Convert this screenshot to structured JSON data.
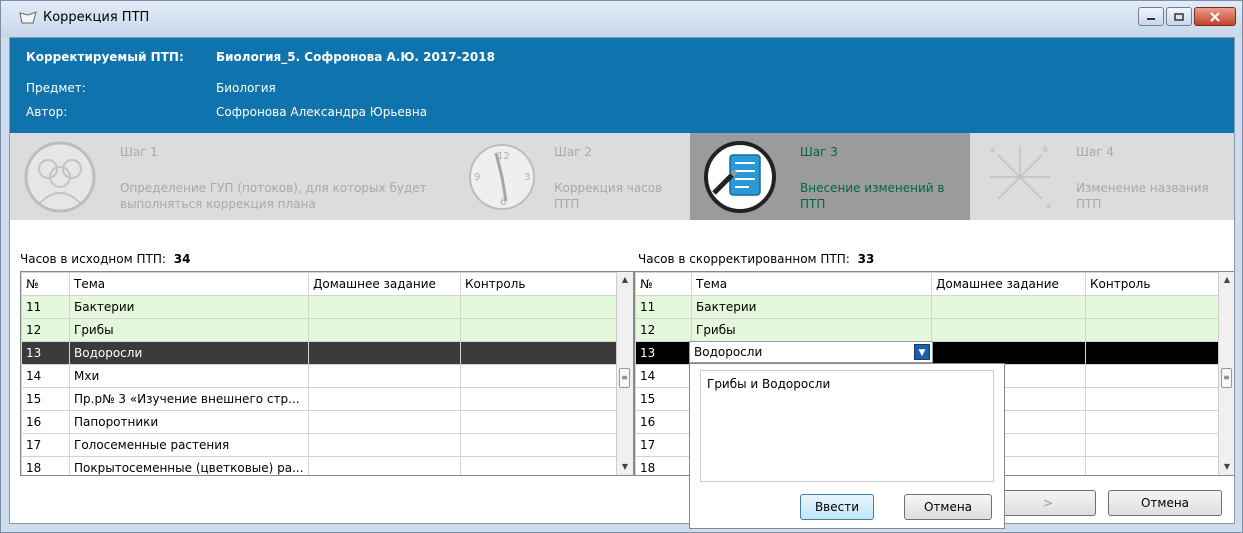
{
  "window": {
    "title": "Коррекция ПТП"
  },
  "header": {
    "corrected_label": "Корректируемый ПТП:",
    "corrected_value": "Биология_5. Софронова А.Ю. 2017-2018",
    "subject_label": "Предмет:",
    "subject_value": "Биология",
    "author_label": "Автор:",
    "author_value": "Софронова  Александра  Юрьевна"
  },
  "steps": [
    {
      "title": "Шаг 1",
      "desc1": "Определение ГУП (потоков), для которых будет",
      "desc2": "выполняться коррекция плана",
      "icon": "people-icon"
    },
    {
      "title": "Шаг 2",
      "desc1": "Коррекция часов",
      "desc2": "ПТП",
      "icon": "clock-icon"
    },
    {
      "title": "Шаг 3",
      "desc1": "Внесение изменений в",
      "desc2": "ПТП",
      "icon": "checklist-icon",
      "active": true
    },
    {
      "title": "Шаг 4",
      "desc1": "Изменение названия",
      "desc2": "ПТП",
      "icon": "fireworks-icon"
    }
  ],
  "left": {
    "hours_label": "Часов в исходном ПТП:",
    "hours_value": "34",
    "columns": [
      "№",
      "Тема",
      "Домашнее задание",
      "Контроль"
    ],
    "rows": [
      {
        "n": "11",
        "topic": "Бактерии",
        "hw": "",
        "ctrl": "",
        "state": "green"
      },
      {
        "n": "12",
        "topic": "Грибы",
        "hw": "",
        "ctrl": "",
        "state": "green"
      },
      {
        "n": "13",
        "topic": "Водоросли",
        "hw": "",
        "ctrl": "",
        "state": "sel"
      },
      {
        "n": "14",
        "topic": "Мхи",
        "hw": "",
        "ctrl": "",
        "state": ""
      },
      {
        "n": "15",
        "topic": "Пр.р№ 3 «Изучение внешнего стр...",
        "hw": "",
        "ctrl": "",
        "state": ""
      },
      {
        "n": "16",
        "topic": "Папоротники",
        "hw": "",
        "ctrl": "",
        "state": ""
      },
      {
        "n": "17",
        "topic": "Голосеменные растения",
        "hw": "",
        "ctrl": "",
        "state": ""
      },
      {
        "n": "18",
        "topic": "Покрытосеменные (цветковые) ра...",
        "hw": "",
        "ctrl": "",
        "state": ""
      }
    ]
  },
  "right": {
    "hours_label": "Часов в скорректированном ПТП:",
    "hours_value": "33",
    "columns": [
      "№",
      "Тема",
      "Домашнее задание",
      "Контроль"
    ],
    "rows": [
      {
        "n": "11",
        "topic": "Бактерии",
        "hw": "",
        "ctrl": "",
        "state": "green"
      },
      {
        "n": "12",
        "topic": "Грибы",
        "hw": "",
        "ctrl": "",
        "state": "green"
      },
      {
        "n": "13",
        "topic": "",
        "hw": "",
        "ctrl": "",
        "state": "selblack"
      },
      {
        "n": "14",
        "topic": "",
        "hw": "",
        "ctrl": "",
        "state": ""
      },
      {
        "n": "15",
        "topic": "",
        "hw": "",
        "ctrl": "",
        "state": ""
      },
      {
        "n": "16",
        "topic": "",
        "hw": "",
        "ctrl": "",
        "state": ""
      },
      {
        "n": "17",
        "topic": "",
        "hw": "",
        "ctrl": "",
        "state": ""
      },
      {
        "n": "18",
        "topic": "",
        "hw": "",
        "ctrl": "",
        "state": ""
      }
    ],
    "combo_value": "Водоросли"
  },
  "popup": {
    "text": "Грибы и Водоросли",
    "enter_label": "Ввести",
    "cancel_label": "Отмена"
  },
  "footer": {
    "next_label": ">",
    "cancel_label": "Отмена"
  }
}
